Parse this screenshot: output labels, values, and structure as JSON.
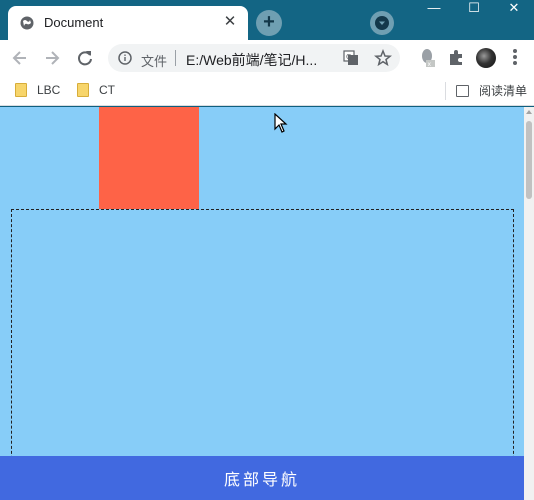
{
  "tab": {
    "title": "Document",
    "close_glyph": "✕",
    "favicon": "globe-icon"
  },
  "new_tab_glyph": "+",
  "window_controls": {
    "minimize": "—",
    "maximize": "☐",
    "close": "✕"
  },
  "omnibox": {
    "security_label": "文件",
    "url": "E:/Web前端/笔记/H..."
  },
  "bookmarks": [
    {
      "label": "LBC",
      "icon": "folder-icon"
    },
    {
      "label": "CT",
      "icon": "folder-icon"
    }
  ],
  "reading_list": {
    "label": "阅读清单",
    "icon": "reading-list-icon"
  },
  "page": {
    "footer_nav_label": "底部导航",
    "colors": {
      "background": "#87cdf8",
      "red_box": "#fe6347",
      "footer": "#4169e0"
    }
  }
}
